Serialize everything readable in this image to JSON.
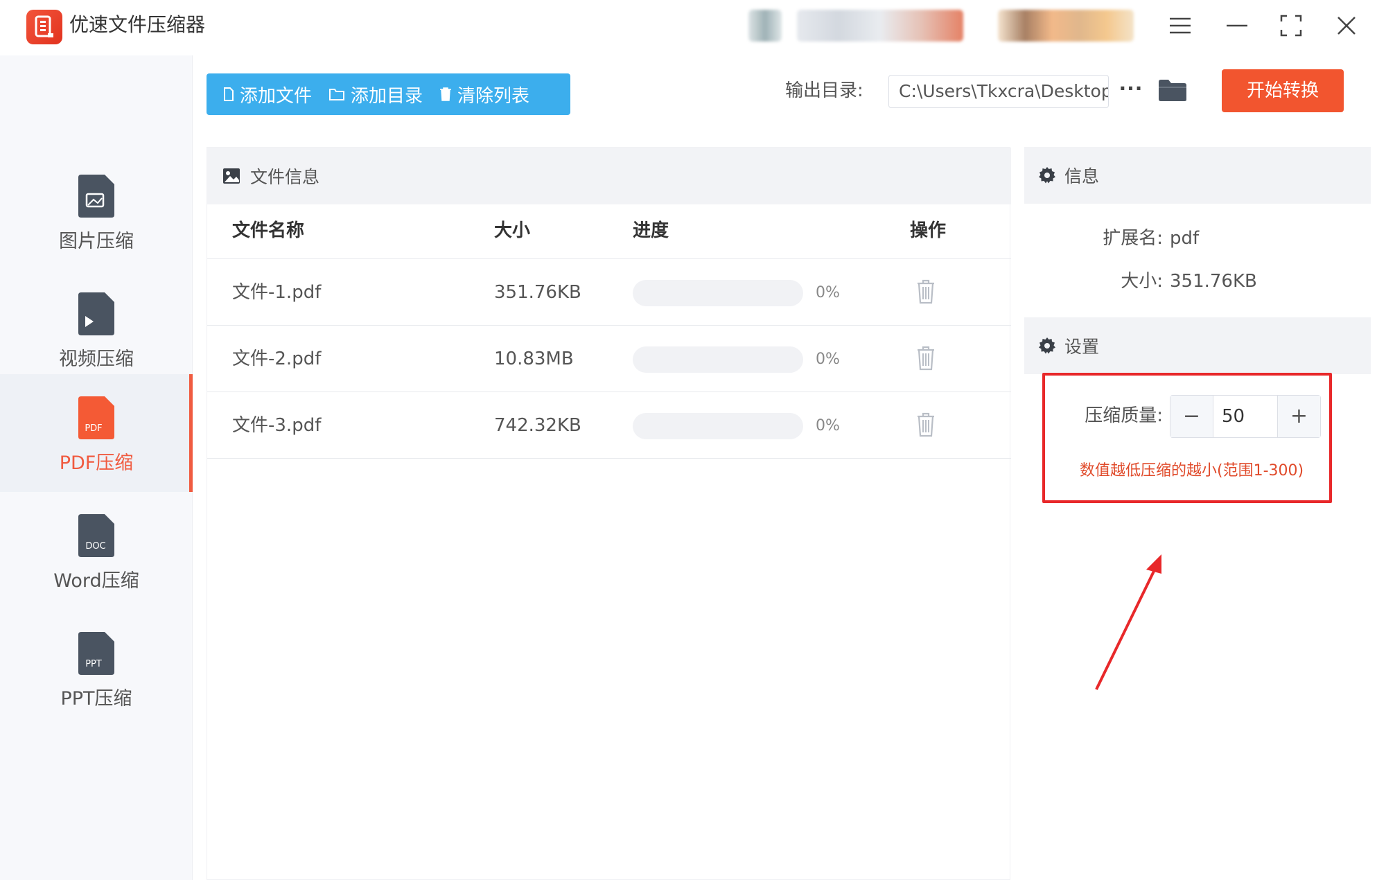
{
  "app": {
    "title": "优速文件压缩器",
    "window_buttons": [
      "menu-icon",
      "minimize-icon",
      "fullscreen-icon",
      "close-icon"
    ]
  },
  "colors": {
    "accent_blue": "#3caeed",
    "accent_orange": "#f2552f",
    "highlight_red": "#e8282a",
    "hint_red": "#e04a2a"
  },
  "sidebar": {
    "items": [
      {
        "label": "图片压缩",
        "icon": "image-file-icon",
        "badge": ""
      },
      {
        "label": "视频压缩",
        "icon": "video-file-icon",
        "badge": ""
      },
      {
        "label": "PDF压缩",
        "icon": "pdf-file-icon",
        "badge": "PDF",
        "active": true
      },
      {
        "label": "Word压缩",
        "icon": "doc-file-icon",
        "badge": "DOC"
      },
      {
        "label": "PPT压缩",
        "icon": "ppt-file-icon",
        "badge": "PPT"
      }
    ]
  },
  "toolbar": {
    "add_file": "添加文件",
    "add_folder": "添加目录",
    "clear_list": "清除列表",
    "output_label": "输出目录:",
    "output_path": "C:\\Users\\Tkxcra\\Desktop",
    "more": "···",
    "start": "开始转换"
  },
  "file_panel": {
    "title": "文件信息",
    "columns": [
      "文件名称",
      "大小",
      "进度",
      "操作"
    ],
    "rows": [
      {
        "name": "文件-1.pdf",
        "size": "351.76KB",
        "progress": 0,
        "progress_text": "0%"
      },
      {
        "name": "文件-2.pdf",
        "size": "10.83MB",
        "progress": 0,
        "progress_text": "0%"
      },
      {
        "name": "文件-3.pdf",
        "size": "742.32KB",
        "progress": 0,
        "progress_text": "0%"
      }
    ]
  },
  "info_panel": {
    "title": "信息",
    "ext_label": "扩展名:",
    "ext_value": "pdf",
    "size_label": "大小:",
    "size_value": "351.76KB"
  },
  "settings_panel": {
    "title": "设置",
    "quality_label": "压缩质量:",
    "quality_value": "50",
    "minus": "−",
    "plus": "+",
    "hint": "数值越低压缩的越小(范围1-300)"
  }
}
